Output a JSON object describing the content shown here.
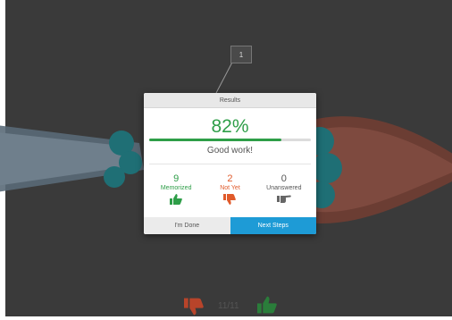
{
  "callout": {
    "label": "1"
  },
  "results": {
    "title": "Results",
    "percent": "82%",
    "progress": 0.82,
    "message": "Good work!",
    "stats": [
      {
        "count": "9",
        "label": "Memorized",
        "color": "#2e9e48",
        "icon": "thumbs-up-icon"
      },
      {
        "count": "2",
        "label": "Not Yet",
        "color": "#e05a2a",
        "icon": "thumbs-down-icon"
      },
      {
        "count": "0",
        "label": "Unanswered",
        "color": "#555555",
        "icon": "pointing-hand-icon"
      }
    ],
    "done_label": "I'm Done",
    "next_label": "Next Steps"
  },
  "footer": {
    "counter": "11/11"
  },
  "colors": {
    "accent_green": "#2e9e48",
    "accent_orange": "#e05a2a",
    "accent_blue": "#1e9bd6"
  }
}
